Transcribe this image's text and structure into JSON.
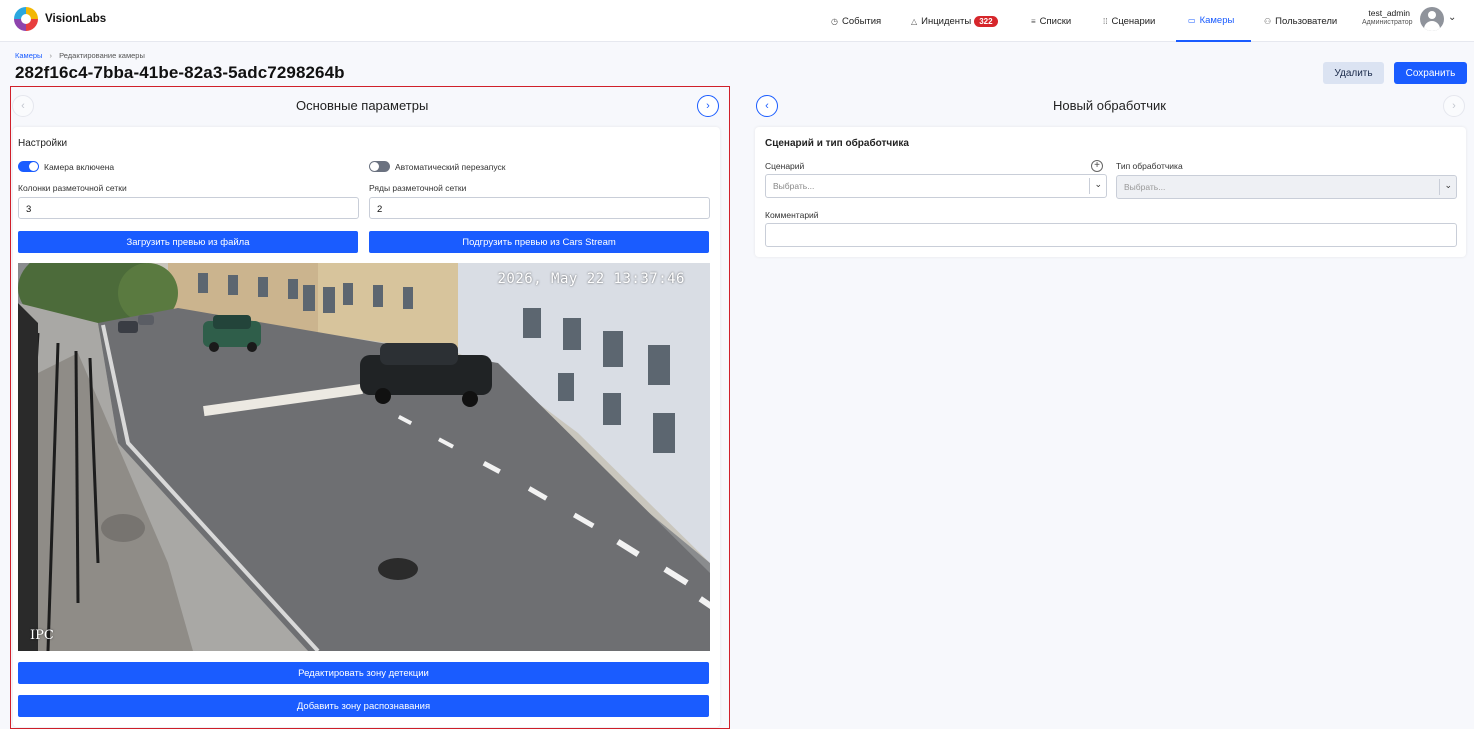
{
  "app": {
    "logo_text": "VisionLabs"
  },
  "nav": {
    "events": {
      "label": "События",
      "icon": "clock-icon"
    },
    "incidents": {
      "label": "Инциденты",
      "icon": "warning-triangle-icon",
      "badge": "322"
    },
    "lists": {
      "label": "Списки",
      "icon": "list-icon"
    },
    "scenarios": {
      "label": "Сценарии",
      "icon": "scenarios-icon"
    },
    "cameras": {
      "label": "Камеры",
      "icon": "camera-icon",
      "active": true
    },
    "users": {
      "label": "Пользователи",
      "icon": "users-icon"
    }
  },
  "user": {
    "name": "test_admin",
    "role": "Администратор"
  },
  "breadcrumb": {
    "root": "Камеры",
    "current": "Редактирование камеры"
  },
  "page": {
    "title": "282f16c4-7bba-41be-82a3-5adc7298264b",
    "delete_label": "Удалить",
    "save_label": "Сохранить"
  },
  "left": {
    "title": "Основные параметры",
    "settings_title": "Настройки",
    "camera_enabled_label": "Камера включена",
    "camera_enabled": true,
    "auto_restart_label": "Автоматический перезапуск",
    "auto_restart": false,
    "columns_label": "Колонки разметочной сетки",
    "columns_value": "3",
    "rows_label": "Ряды разметочной сетки",
    "rows_value": "2",
    "upload_file_label": "Загрузить превью из файла",
    "upload_stream_label": "Подгрузить превью из Cars Stream",
    "preview_timestamp": "2026, May 22 13:37:46",
    "preview_watermark": "IPC",
    "edit_detection_zone_label": "Редактировать зону детекции",
    "add_recognition_zone_label": "Добавить зону распознавания"
  },
  "right": {
    "title": "Новый обработчик",
    "section_title": "Сценарий и тип обработчика",
    "scenario_label": "Сценарий",
    "scenario_placeholder": "Выбрать...",
    "handler_type_label": "Тип обработчика",
    "handler_type_placeholder": "Выбрать...",
    "comment_label": "Комментарий",
    "comment_value": ""
  },
  "colors": {
    "accent": "#1a5cff",
    "badge": "#d6262b",
    "highlight_border": "#d0202a"
  }
}
